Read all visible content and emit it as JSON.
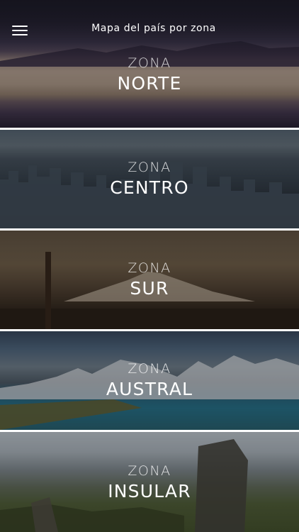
{
  "header": {
    "title": "Mapa del país por zona",
    "menu_icon": "hamburger-menu-icon"
  },
  "zones": [
    {
      "kicker": "ZONA",
      "name": "NORTE"
    },
    {
      "kicker": "ZONA",
      "name": "CENTRO"
    },
    {
      "kicker": "ZONA",
      "name": "SUR"
    },
    {
      "kicker": "ZONA",
      "name": "AUSTRAL"
    },
    {
      "kicker": "ZONA",
      "name": "INSULAR"
    }
  ],
  "colors": {
    "text": "#ffffff",
    "divider": "#ffffff"
  }
}
